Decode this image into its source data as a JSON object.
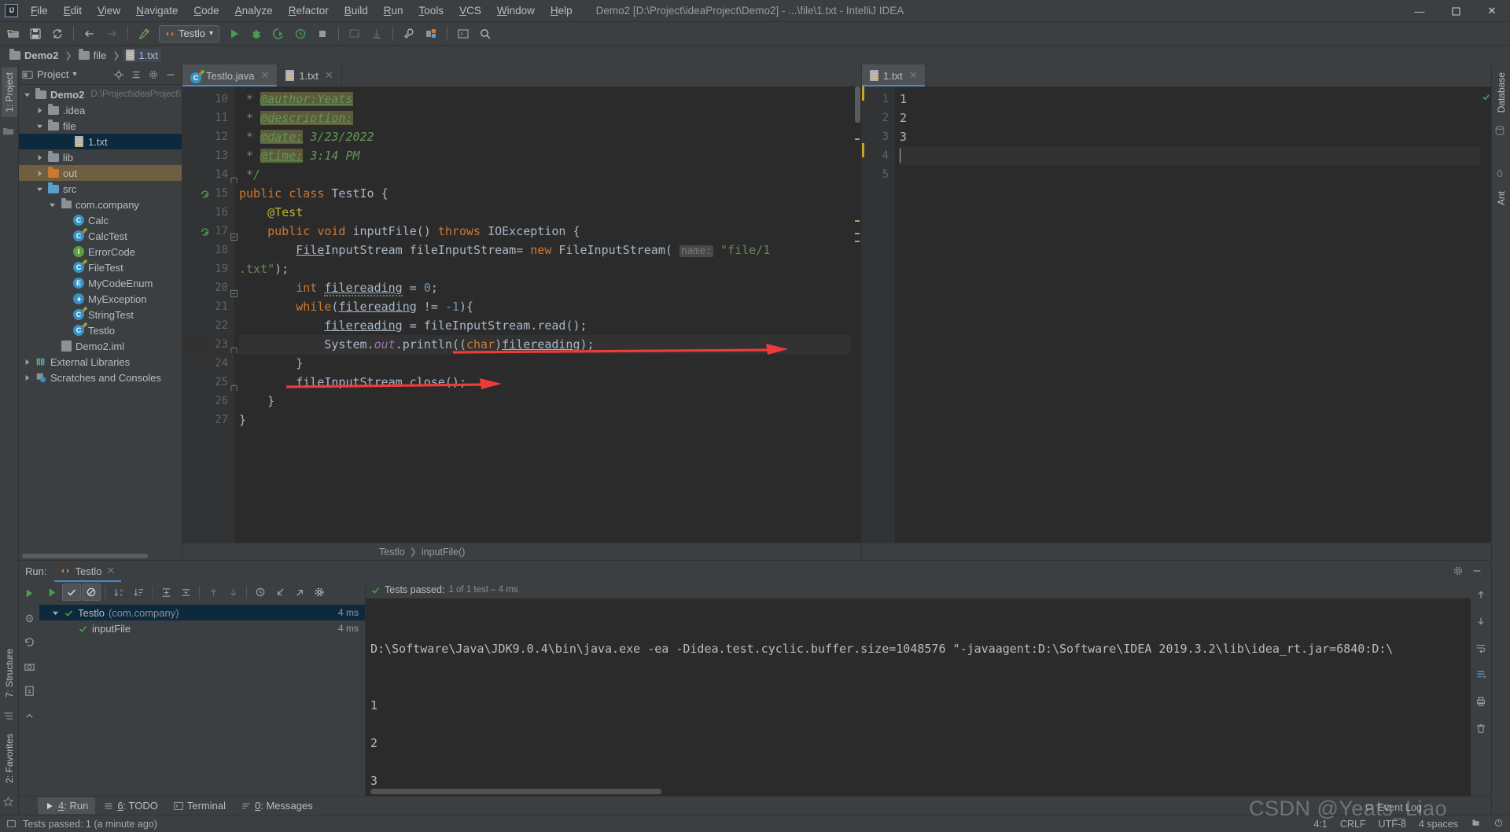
{
  "window": {
    "title": "Demo2 [D:\\Project\\ideaProject\\Demo2] - ...\\file\\1.txt - IntelliJ IDEA",
    "logo": "IJ",
    "minimize": "—",
    "maximize": "⬜",
    "close": "✕"
  },
  "menu": [
    {
      "label": "File"
    },
    {
      "label": "Edit"
    },
    {
      "label": "View"
    },
    {
      "label": "Navigate"
    },
    {
      "label": "Code"
    },
    {
      "label": "Analyze"
    },
    {
      "label": "Refactor"
    },
    {
      "label": "Build"
    },
    {
      "label": "Run"
    },
    {
      "label": "Tools"
    },
    {
      "label": "VCS"
    },
    {
      "label": "Window"
    },
    {
      "label": "Help"
    }
  ],
  "toolbar": {
    "icons": [
      "open-folder-icon",
      "save-all-icon",
      "sync-icon",
      "back-arrow-icon",
      "forward-arrow-icon",
      "build-hammer-icon"
    ],
    "run_config": "Testlo",
    "run_config_dropdown": "▾",
    "actions": [
      "run-icon",
      "debug-icon",
      "run-with-coverage-icon",
      "profile-icon",
      "stop-icon",
      "update-app-icon",
      "deploy-icon",
      "settings-wrench-icon",
      "project-structure-icon",
      "terminal-icon",
      "search-everywhere-icon"
    ]
  },
  "breadcrumb": [
    {
      "label": "Demo2",
      "icon": "module-folder-icon"
    },
    {
      "label": "file",
      "icon": "folder-icon"
    },
    {
      "label": "1.txt",
      "icon": "text-file-icon"
    }
  ],
  "left_strip": {
    "project_tab": "1: Project",
    "structure_tab": "7: Structure",
    "favorites_tab": "2: Favorites"
  },
  "right_strip": {
    "database_tab": "Database",
    "ant_tab": "Ant"
  },
  "project_panel": {
    "title": "Project",
    "dropdown": "▾",
    "actions": [
      "locate-icon",
      "collapse-all-icon",
      "settings-gear-icon",
      "hide-icon"
    ],
    "tree": [
      {
        "label": "Demo2",
        "sub": "D:\\Project\\ideaProject\\",
        "depth": 0,
        "arrow": "down",
        "icon": "module-folder-icon",
        "bold": true,
        "state": "none"
      },
      {
        "label": ".idea",
        "sub": "",
        "depth": 1,
        "arrow": "right",
        "icon": "folder-gray-icon",
        "bold": false,
        "state": "none"
      },
      {
        "label": "file",
        "sub": "",
        "depth": 1,
        "arrow": "down",
        "icon": "folder-resource-icon",
        "bold": false,
        "state": "none"
      },
      {
        "label": "1.txt",
        "sub": "",
        "depth": 3,
        "arrow": "none",
        "icon": "text-file-icon",
        "bold": false,
        "state": "selected-blue"
      },
      {
        "label": "lib",
        "sub": "",
        "depth": 1,
        "arrow": "right",
        "icon": "folder-gray-icon",
        "bold": false,
        "state": "none"
      },
      {
        "label": "out",
        "sub": "",
        "depth": 1,
        "arrow": "right",
        "icon": "folder-orange-icon",
        "bold": false,
        "state": "selected-brown"
      },
      {
        "label": "src",
        "sub": "",
        "depth": 1,
        "arrow": "down",
        "icon": "folder-source-icon",
        "bold": false,
        "state": "none"
      },
      {
        "label": "com.company",
        "sub": "",
        "depth": 2,
        "arrow": "down",
        "icon": "package-icon",
        "bold": false,
        "state": "none"
      },
      {
        "label": "Calc",
        "sub": "",
        "depth": 3,
        "arrow": "none",
        "icon": "class-icon",
        "bold": false,
        "state": "none"
      },
      {
        "label": "CalcTest",
        "sub": "",
        "depth": 3,
        "arrow": "none",
        "icon": "test-class-icon",
        "bold": false,
        "state": "none"
      },
      {
        "label": "ErrorCode",
        "sub": "",
        "depth": 3,
        "arrow": "none",
        "icon": "interface-icon",
        "bold": false,
        "state": "none"
      },
      {
        "label": "FileTest",
        "sub": "",
        "depth": 3,
        "arrow": "none",
        "icon": "test-class-icon",
        "bold": false,
        "state": "none"
      },
      {
        "label": "MyCodeEnum",
        "sub": "",
        "depth": 3,
        "arrow": "none",
        "icon": "enum-icon",
        "bold": false,
        "state": "none"
      },
      {
        "label": "MyException",
        "sub": "",
        "depth": 3,
        "arrow": "none",
        "icon": "exception-class-icon",
        "bold": false,
        "state": "none"
      },
      {
        "label": "StringTest",
        "sub": "",
        "depth": 3,
        "arrow": "none",
        "icon": "test-class-icon",
        "bold": false,
        "state": "none"
      },
      {
        "label": "Testlo",
        "sub": "",
        "depth": 3,
        "arrow": "none",
        "icon": "test-class-icon",
        "bold": false,
        "state": "none"
      },
      {
        "label": "Demo2.iml",
        "sub": "",
        "depth": 2,
        "arrow": "none",
        "icon": "iml-file-icon",
        "bold": false,
        "state": "none"
      },
      {
        "label": "External Libraries",
        "sub": "",
        "depth": 0,
        "arrow": "right",
        "icon": "libraries-icon",
        "bold": false,
        "state": "none"
      },
      {
        "label": "Scratches and Consoles",
        "sub": "",
        "depth": 0,
        "arrow": "right",
        "icon": "scratches-icon",
        "bold": false,
        "state": "none"
      }
    ]
  },
  "editor_left": {
    "tabs": [
      {
        "label": "Testlo.java",
        "icon": "java-class-icon",
        "active": true,
        "close": "✕"
      },
      {
        "label": "1.txt",
        "icon": "text-file-icon",
        "active": false,
        "close": ""
      }
    ],
    "first_line_number": 10,
    "lines": [
      {
        "n": 10,
        "gutter_mark": "",
        "fold": "",
        "highlight": false
      },
      {
        "n": 11,
        "gutter_mark": "",
        "fold": "",
        "highlight": false
      },
      {
        "n": 12,
        "gutter_mark": "",
        "fold": "",
        "highlight": false
      },
      {
        "n": 13,
        "gutter_mark": "",
        "fold": "",
        "highlight": false
      },
      {
        "n": 14,
        "gutter_mark": "",
        "fold": "end",
        "highlight": false
      },
      {
        "n": 15,
        "gutter_mark": "run-test-icon",
        "fold": "",
        "highlight": false
      },
      {
        "n": 16,
        "gutter_mark": "",
        "fold": "",
        "highlight": false
      },
      {
        "n": 17,
        "gutter_mark": "run-test-icon",
        "fold": "start",
        "highlight": false
      },
      {
        "n": 18,
        "gutter_mark": "",
        "fold": "",
        "highlight": false
      },
      {
        "n": 19,
        "gutter_mark": "",
        "fold": "",
        "highlight": false
      },
      {
        "n": 20,
        "gutter_mark": "",
        "fold": "start",
        "highlight": false
      },
      {
        "n": 21,
        "gutter_mark": "",
        "fold": "",
        "highlight": false
      },
      {
        "n": 22,
        "gutter_mark": "",
        "fold": "",
        "highlight": false
      },
      {
        "n": 23,
        "gutter_mark": "",
        "fold": "end",
        "highlight": true
      },
      {
        "n": 24,
        "gutter_mark": "",
        "fold": "",
        "highlight": false
      },
      {
        "n": 25,
        "gutter_mark": "",
        "fold": "end",
        "highlight": false
      },
      {
        "n": 26,
        "gutter_mark": "",
        "fold": "",
        "highlight": false
      },
      {
        "n": 27,
        "gutter_mark": "",
        "fold": "",
        "highlight": false
      }
    ],
    "code_text": [
      " * @author:Yeats",
      " * @description:",
      " * @date: 3/23/2022",
      " * @time: 3:14 PM",
      " */",
      "public class TestIo {",
      "    @Test",
      "    public void inputFile() throws IOException {",
      "        FileInputStream fileInputStream= new FileInputStream( name: \"file/1",
      ".txt\");",
      "        int filereading = 0;",
      "        while(filereading != -1){",
      "            filereading = fileInputStream.read();",
      "            System.out.println((char)filereading);",
      "        }",
      "        fileInputStream.close();",
      "    }",
      "}"
    ],
    "parameter_hint": "name:",
    "breadcrumb_footer": [
      "Testlo",
      "inputFile()"
    ]
  },
  "editor_right": {
    "tab": {
      "label": "1.txt",
      "icon": "text-file-icon",
      "close": "✕"
    },
    "lines": [
      "1",
      "2",
      "3",
      "",
      ""
    ],
    "line_numbers": [
      "1",
      "2",
      "3",
      "4",
      "5"
    ],
    "cursor_line": 4
  },
  "run_panel": {
    "label": "Run:",
    "tab": "Testlo",
    "tab_close": "✕",
    "toolbar_icons": [
      "rerun-icon",
      "show-passed-icon",
      "hide-ignored-icon",
      "sort-alphabetically-icon",
      "sort-by-duration-icon",
      "expand-all-icon",
      "collapse-all-icon",
      "prev-failed-icon",
      "next-failed-icon",
      "history-icon",
      "import-tests-icon",
      "export-tests-icon",
      "test-settings-icon"
    ],
    "status": "Tests passed:",
    "status_detail": "1 of 1 test – 4 ms",
    "tests": [
      {
        "label": "Testlo",
        "package": "(com.company)",
        "ms": "4 ms",
        "depth": 0,
        "selected": true,
        "arrow": "down"
      },
      {
        "label": "inputFile",
        "package": "",
        "ms": "4 ms",
        "depth": 1,
        "selected": false,
        "arrow": "none"
      }
    ],
    "console_command": "D:\\Software\\Java\\JDK9.0.4\\bin\\java.exe -ea -Didea.test.cyclic.buffer.size=1048576 \"-javaagent:D:\\Software\\IDEA 2019.3.2\\lib\\idea_rt.jar=6840:D:\\",
    "console_output": [
      "1",
      "",
      "2",
      "",
      "3"
    ],
    "sidebar_icons": [
      "debugger-icon",
      "rerun-failed-icon",
      "camera-icon",
      "export-icon",
      "minimize-icon"
    ],
    "right_icons": [
      "scroll-up-icon",
      "scroll-down-icon",
      "soft-wrap-icon",
      "scroll-to-end-icon",
      "print-icon",
      "clear-all-icon"
    ],
    "settings_icon": "gear-icon",
    "hide_icon": "hide-icon"
  },
  "toolwindow_bar": [
    {
      "label": "4: Run",
      "icon": "run-icon",
      "active": true
    },
    {
      "label": "6: TODO",
      "icon": "todo-icon",
      "active": false
    },
    {
      "label": "Terminal",
      "icon": "terminal-icon",
      "active": false
    },
    {
      "label": "0: Messages",
      "icon": "messages-icon",
      "active": false
    }
  ],
  "statusbar": {
    "message": "Tests passed: 1 (a minute ago)",
    "position": "4:1",
    "line_separator": "CRLF",
    "encoding": "UTF-8",
    "indent": "4 spaces",
    "event_log": "Event Log",
    "watermark": "CSDN @Yeats_Liao"
  },
  "colors": {
    "bg_chrome": "#3c3f41",
    "bg_editor": "#2b2b2b",
    "accent_blue": "#4a88c7",
    "selection_blue": "#0d293e",
    "selection_brown": "#6e5f40",
    "green": "#499c54",
    "orange": "#cc7832",
    "annotation_red": "#f03a3a"
  }
}
